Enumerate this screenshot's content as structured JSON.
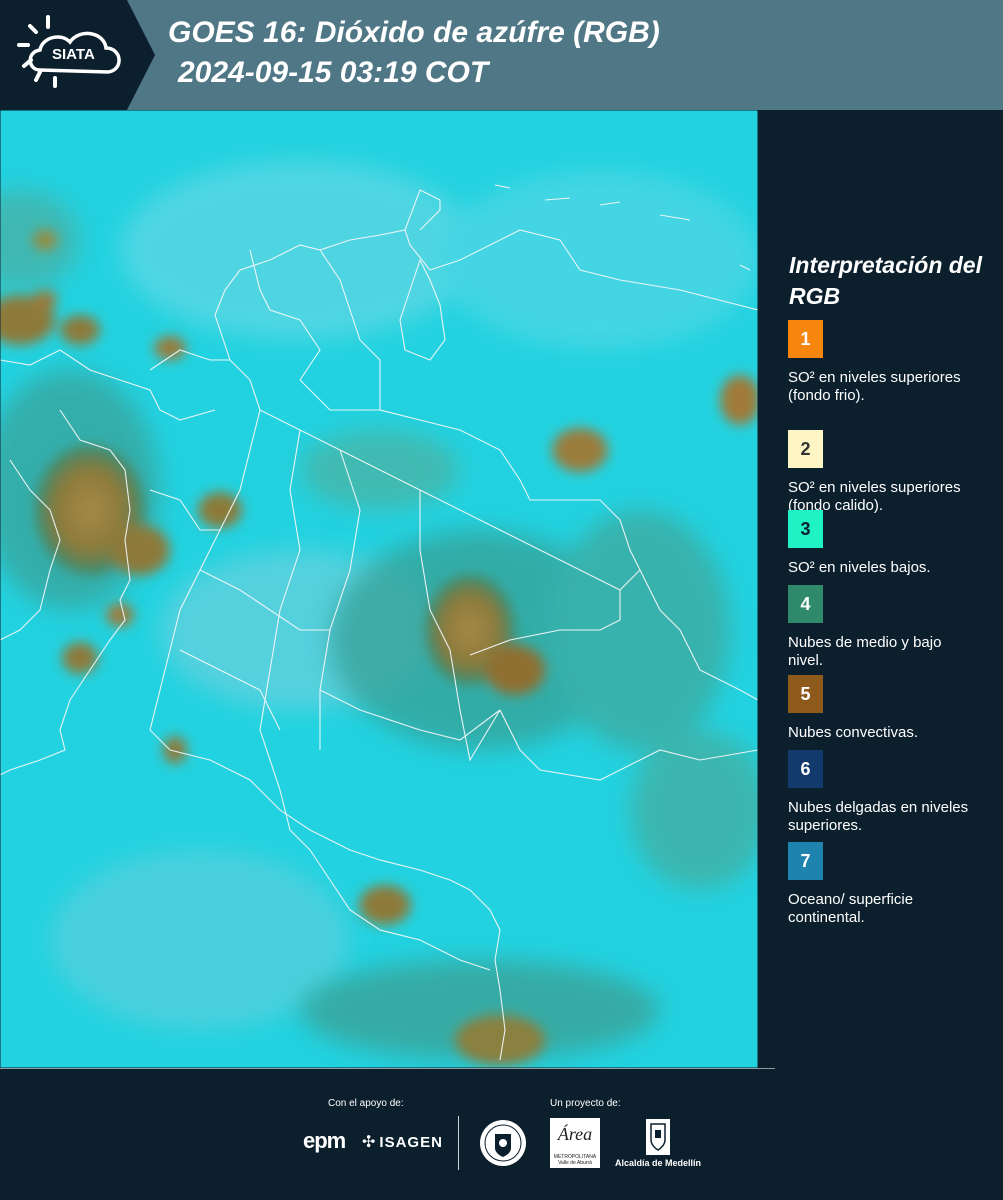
{
  "header": {
    "logo_text": "SIATA",
    "title_line1": "GOES 16: Dióxido de azúfre (RGB)",
    "title_line2": "2024-09-15 03:19 COT"
  },
  "legend": {
    "title": "Interpretación del RGB",
    "items": [
      {
        "number": "1",
        "text": "SO² en niveles superiores (fondo frio).",
        "color": "#f7860e",
        "number_color": "#ffffff"
      },
      {
        "number": "2",
        "text": "SO² en niveles superiores (fondo calido).",
        "color": "#fdf6c4",
        "number_color": "#333333"
      },
      {
        "number": "3",
        "text": "SO² en niveles bajos.",
        "color": "#1ff2c4",
        "number_color": "#0c1f2d"
      },
      {
        "number": "4",
        "text": "Nubes de medio y bajo nivel.",
        "color": "#2e8a6a",
        "number_color": "#ffffff"
      },
      {
        "number": "5",
        "text": "Nubes convectivas.",
        "color": "#8d5a1c",
        "number_color": "#ffffff"
      },
      {
        "number": "6",
        "text": "Nubes delgadas en niveles superiores.",
        "color": "#123a6c",
        "number_color": "#ffffff"
      },
      {
        "number": "7",
        "text": "Oceano/ superficie continental.",
        "color": "#1e84ad",
        "number_color": "#ffffff"
      }
    ]
  },
  "footer": {
    "support_caption": "Con el apoyo de:",
    "project_caption": "Un proyecto de:",
    "epm_logo": "epm",
    "isagen_logo": "ISAGEN",
    "area_logo": "Área",
    "area_logo_sub": "METROPOLITANA Valle de Aburrá",
    "alcaldia_label": "Alcaldía de Medellín"
  },
  "colors": {
    "header_bg": "#4f7786",
    "panel_bg": "#0c1f2d",
    "ocean": "#22d2e0",
    "convective": "#8d7a3a",
    "mid_level": "#3aa39a"
  }
}
